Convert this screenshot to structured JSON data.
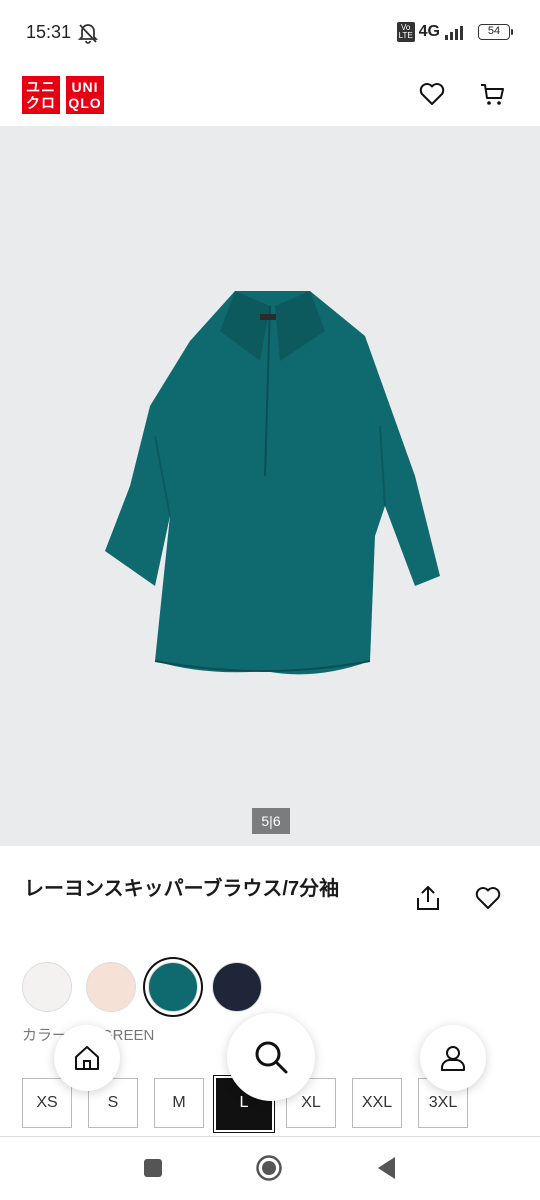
{
  "status": {
    "time": "15:31",
    "network": "4G",
    "volte": "Vo LTE",
    "battery": "54"
  },
  "header": {
    "logo_line1": "ユニ クロ",
    "logo_line2": "UNI QLO",
    "icons": [
      "heart-icon",
      "cart-icon"
    ]
  },
  "gallery": {
    "pager": "5|6",
    "product_color": "#0f6a6f",
    "background": "#e9ebec"
  },
  "product": {
    "title": "レーヨンスキッパーブラウス/7分袖",
    "color_caption_prefix": "カラー",
    "color_caption_value": "GREEN",
    "swatches": [
      {
        "name": "white",
        "color": "#f3f2f0"
      },
      {
        "name": "pink",
        "color": "#f6e1d6"
      },
      {
        "name": "green",
        "color": "#0f6a6f",
        "selected": true
      },
      {
        "name": "navy",
        "color": "#20263a"
      }
    ],
    "sizes": [
      "XS",
      "S",
      "M",
      "L",
      "XL",
      "XXL",
      "3XL"
    ],
    "selected_size": "L"
  },
  "bottom_nav": {
    "icons": [
      "home-icon",
      "search-icon",
      "account-icon"
    ]
  },
  "system_nav": {
    "icons": [
      "recents-icon",
      "home-circle-icon",
      "back-icon"
    ]
  }
}
